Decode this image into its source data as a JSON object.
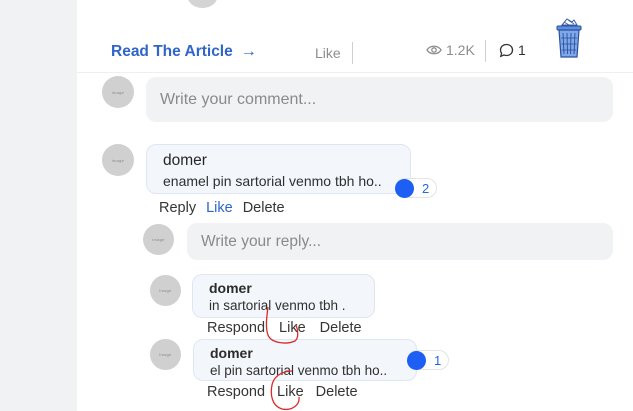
{
  "article": {
    "read_link_label": "Read The Article",
    "like_label": "Like",
    "views": "1.2K",
    "comments_count": "1"
  },
  "comment_input": {
    "placeholder": "Write your comment..."
  },
  "avatar_placeholder_text": "image",
  "comment": {
    "author": "domer",
    "text": "enamel pin sartorial venmo tbh ho..",
    "likes": "2",
    "actions": {
      "reply": "Reply",
      "like": "Like",
      "delete": "Delete"
    }
  },
  "reply_input": {
    "placeholder": "Write your reply..."
  },
  "replies": [
    {
      "author": "domer",
      "text": "in sartorial venmo tbh .",
      "actions": {
        "respond": "Respond",
        "like": "Like",
        "delete": "Delete"
      }
    },
    {
      "author": "domer",
      "text": "el pin sartorial venmo tbh ho..",
      "likes": "1",
      "actions": {
        "respond": "Respond",
        "like": "Like",
        "delete": "Delete"
      }
    }
  ],
  "colors": {
    "accent": "#2f64c9",
    "like_dot": "#1d5ef5",
    "annotation": "#d92a2a",
    "trash": "#4a7fd4"
  }
}
